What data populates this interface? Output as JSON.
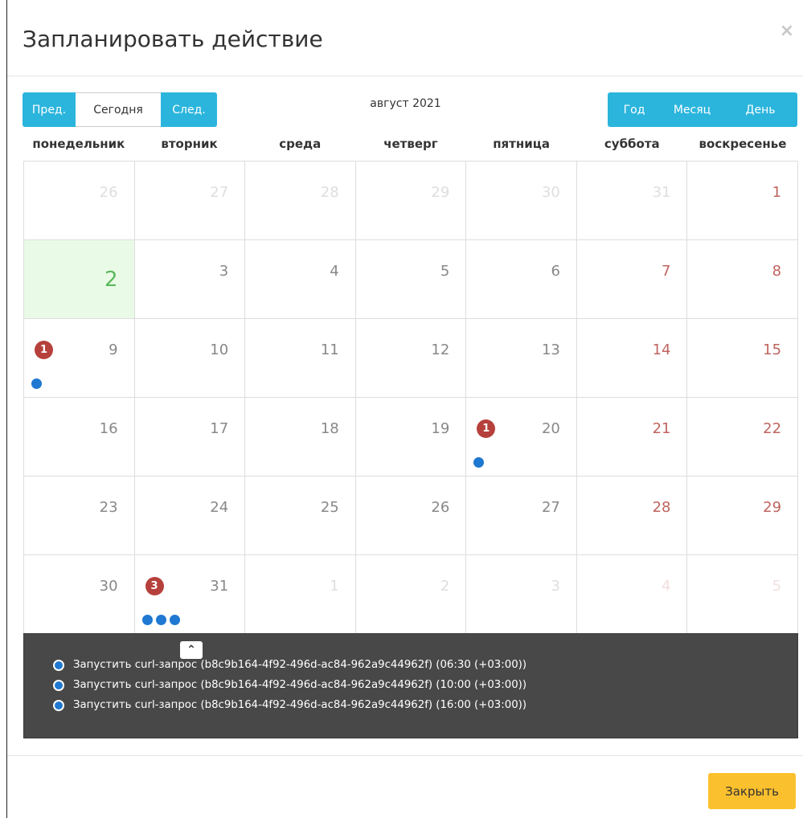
{
  "modal": {
    "title": "Запланировать действие",
    "close_icon": "×"
  },
  "nav": {
    "prev": "Пред.",
    "today": "Сегодня",
    "next": "След."
  },
  "calendar_title": "август 2021",
  "views": {
    "year": "Год",
    "month": "Месяц",
    "day": "День"
  },
  "weekdays": [
    "понедельник",
    "вторник",
    "среда",
    "четверг",
    "пятница",
    "суббота",
    "воскресенье"
  ],
  "weeks": [
    [
      {
        "day": "26",
        "other": true
      },
      {
        "day": "27",
        "other": true
      },
      {
        "day": "28",
        "other": true
      },
      {
        "day": "29",
        "other": true
      },
      {
        "day": "30",
        "other": true
      },
      {
        "day": "31",
        "other": true
      },
      {
        "day": "1",
        "other": false,
        "weekend": true
      }
    ],
    [
      {
        "day": "2",
        "today": true
      },
      {
        "day": "3"
      },
      {
        "day": "4"
      },
      {
        "day": "5"
      },
      {
        "day": "6"
      },
      {
        "day": "7",
        "weekend": true
      },
      {
        "day": "8",
        "weekend": true
      }
    ],
    [
      {
        "day": "9",
        "badge": "1",
        "dots": 1
      },
      {
        "day": "10"
      },
      {
        "day": "11"
      },
      {
        "day": "12"
      },
      {
        "day": "13"
      },
      {
        "day": "14",
        "weekend": true
      },
      {
        "day": "15",
        "weekend": true
      }
    ],
    [
      {
        "day": "16"
      },
      {
        "day": "17"
      },
      {
        "day": "18"
      },
      {
        "day": "19"
      },
      {
        "day": "20",
        "badge": "1",
        "dots": 1
      },
      {
        "day": "21",
        "weekend": true
      },
      {
        "day": "22",
        "weekend": true
      }
    ],
    [
      {
        "day": "23"
      },
      {
        "day": "24"
      },
      {
        "day": "25"
      },
      {
        "day": "26"
      },
      {
        "day": "27"
      },
      {
        "day": "28",
        "weekend": true
      },
      {
        "day": "29",
        "weekend": true
      }
    ],
    [
      {
        "day": "30"
      },
      {
        "day": "31",
        "badge": "3",
        "dots": 3
      },
      {
        "day": "1",
        "other": true
      },
      {
        "day": "2",
        "other": true
      },
      {
        "day": "3",
        "other": true
      },
      {
        "day": "4",
        "other": true,
        "weekend": true
      },
      {
        "day": "5",
        "other": true,
        "weekend": true
      }
    ]
  ],
  "popover": {
    "caret_icon": "⌃",
    "events": [
      "Запустить curl-запрос (b8c9b164-4f92-496d-ac84-962a9c44962f) (06:30 (+03:00))",
      "Запустить curl-запрос (b8c9b164-4f92-496d-ac84-962a9c44962f) (10:00 (+03:00))",
      "Запустить curl-запрос (b8c9b164-4f92-496d-ac84-962a9c44962f) (16:00 (+03:00))"
    ]
  },
  "footer": {
    "close_label": "Закрыть"
  },
  "colors": {
    "accent": "#2bb5dd",
    "today_bg": "#e9fbe6",
    "badge": "#b6403b",
    "event_dot": "#1f78d1",
    "close_btn": "#fbc02d"
  }
}
